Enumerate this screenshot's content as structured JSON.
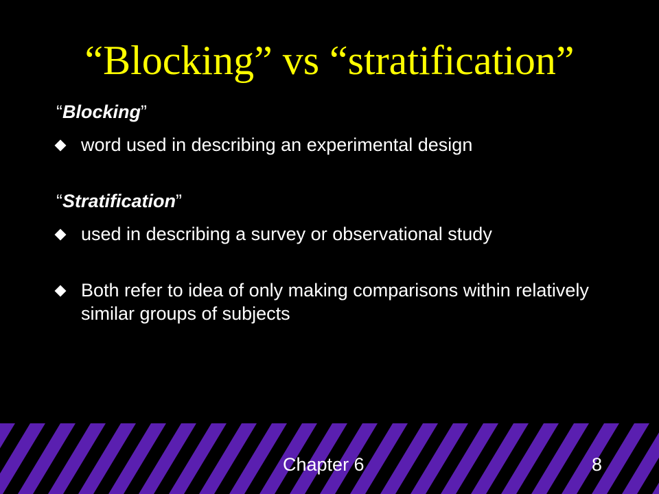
{
  "slide": {
    "title": "“Blocking” vs “stratification”",
    "sections": [
      {
        "term_open_quote": "“",
        "term": "Blocking",
        "term_close_quote": "”",
        "bullets": [
          "word used in describing an experimental design"
        ]
      },
      {
        "term_open_quote": "“",
        "term": "Stratification",
        "term_close_quote": "”",
        "bullets": [
          "used in describing a survey or observational study",
          "Both refer to idea of only making comparisons within relatively similar groups of subjects"
        ]
      }
    ],
    "footer": {
      "chapter": "Chapter 6",
      "page": "8"
    },
    "colors": {
      "background": "#000000",
      "title": "#ffff00",
      "text": "#ffffff",
      "stripe": "#5a1fb0"
    }
  }
}
